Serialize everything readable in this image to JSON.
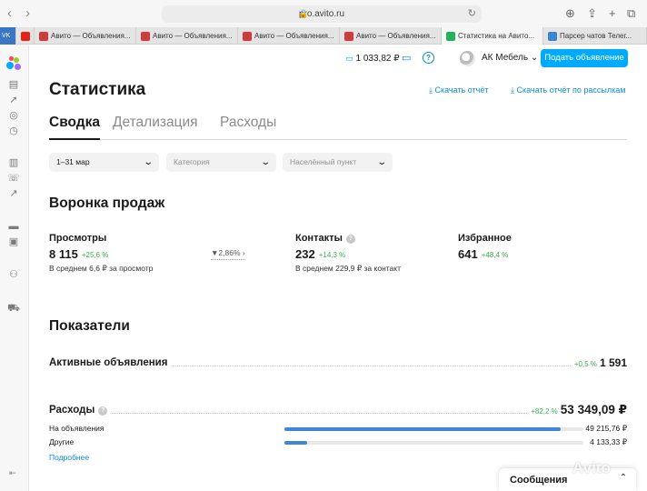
{
  "browser": {
    "url": "pro.avito.ru",
    "tabs": [
      {
        "label": "Авито — Объявления...",
        "favicon_color": "#d23b3b"
      },
      {
        "label": "Авито — Объявления...",
        "favicon_color": "#d23b3b"
      },
      {
        "label": "Авито — Объявления...",
        "favicon_color": "#d23b3b"
      },
      {
        "label": "Авито — Объявления...",
        "favicon_color": "#d23b3b"
      },
      {
        "label": "Статистика на Авито...",
        "favicon_color": "#22b45c"
      },
      {
        "label": "Парсер чатов Телег...",
        "favicon_color": "#3b84d2"
      }
    ],
    "pinned_vk": "VK"
  },
  "header": {
    "balance": "1 033,82 ₽",
    "user_name": "АК Мебель",
    "post_button": "Подать объявление"
  },
  "page": {
    "title": "Статистика",
    "download_report": "Скачать отчёт",
    "download_mailing": "Скачать отчёт по рассылкам"
  },
  "tabs": [
    {
      "label": "Сводка",
      "active": true
    },
    {
      "label": "Детализация",
      "active": false
    },
    {
      "label": "Расходы",
      "active": false
    }
  ],
  "filters": {
    "period": "1–31 мар",
    "category": "Категория",
    "city": "Населённый пункт"
  },
  "funnel": {
    "title": "Воронка продаж",
    "views": {
      "label": "Просмотры",
      "value": "8 115",
      "delta": "+25,6 %",
      "sub": "В среднем 6,6 ₽ за просмотр"
    },
    "conversion": "2,86%",
    "contacts": {
      "label": "Контакты",
      "value": "232",
      "delta": "+14,3 %",
      "sub": "В среднем 229,9 ₽ за контакт"
    },
    "favorites": {
      "label": "Избранное",
      "value": "641",
      "delta": "+48,4 %"
    }
  },
  "indicators": {
    "title": "Показатели",
    "active_ads": {
      "label": "Активные объявления",
      "delta": "+0,5 %",
      "value": "1 591"
    },
    "expenses": {
      "label": "Расходы",
      "delta": "+82,2 %",
      "value": "53 349,09 ₽",
      "items": [
        {
          "label": "На объявления",
          "value": "49 215,76 ₽",
          "share": 0.923
        },
        {
          "label": "Другие",
          "value": "4 133,33 ₽",
          "share": 0.077
        }
      ],
      "more": "Подробнее"
    }
  },
  "messages": {
    "label": "Сообщения"
  },
  "watermark": "Avito",
  "colors": {
    "accent": "#00aaff",
    "link": "#0a8cd6",
    "positive": "#36b24d",
    "bar": "#3e86d9"
  }
}
